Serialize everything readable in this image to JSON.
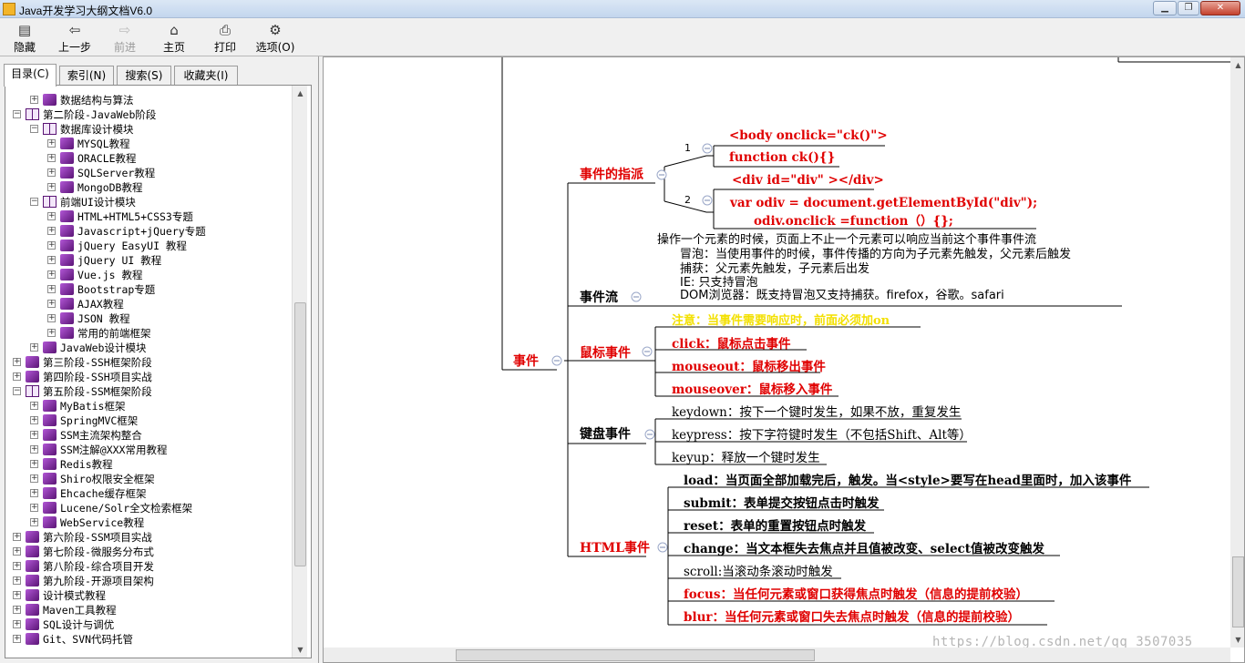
{
  "window": {
    "title": "Java开发学习大纲文档V6.0"
  },
  "toolbar": {
    "buttons": [
      {
        "label": "隐藏",
        "icon": "hide-icon"
      },
      {
        "label": "上一步",
        "icon": "back-arrow-icon"
      },
      {
        "label": "前进",
        "icon": "forward-arrow-icon"
      },
      {
        "label": "主页",
        "icon": "home-icon"
      },
      {
        "label": "打印",
        "icon": "print-icon"
      },
      {
        "label": "选项(O)",
        "icon": "options-icon"
      }
    ]
  },
  "tabs": [
    "目录(C)",
    "索引(N)",
    "搜索(S)",
    "收藏夹(I)"
  ],
  "tree": [
    {
      "level": 1,
      "exp": "+",
      "book": "closed",
      "label": "数据结构与算法"
    },
    {
      "level": 0,
      "exp": "-",
      "book": "open",
      "label": "第二阶段-JavaWeb阶段"
    },
    {
      "level": 1,
      "exp": "-",
      "book": "open",
      "label": "数据库设计模块"
    },
    {
      "level": 2,
      "exp": "+",
      "book": "closed",
      "label": "MYSQL教程"
    },
    {
      "level": 2,
      "exp": "+",
      "book": "closed",
      "label": "ORACLE教程"
    },
    {
      "level": 2,
      "exp": "+",
      "book": "closed",
      "label": "SQLServer教程"
    },
    {
      "level": 2,
      "exp": "+",
      "book": "closed",
      "label": "MongoDB教程"
    },
    {
      "level": 1,
      "exp": "-",
      "book": "open",
      "label": "前端UI设计模块"
    },
    {
      "level": 2,
      "exp": "+",
      "book": "closed",
      "label": "HTML+HTML5+CSS3专题"
    },
    {
      "level": 2,
      "exp": "+",
      "book": "closed",
      "label": "Javascript+jQuery专题"
    },
    {
      "level": 2,
      "exp": "+",
      "book": "closed",
      "label": "jQuery EasyUI 教程"
    },
    {
      "level": 2,
      "exp": "+",
      "book": "closed",
      "label": "jQuery UI 教程"
    },
    {
      "level": 2,
      "exp": "+",
      "book": "closed",
      "label": "Vue.js 教程"
    },
    {
      "level": 2,
      "exp": "+",
      "book": "closed",
      "label": "Bootstrap专题"
    },
    {
      "level": 2,
      "exp": "+",
      "book": "closed",
      "label": "AJAX教程"
    },
    {
      "level": 2,
      "exp": "+",
      "book": "closed",
      "label": "JSON 教程"
    },
    {
      "level": 2,
      "exp": "+",
      "book": "closed",
      "label": "常用的前端框架"
    },
    {
      "level": 1,
      "exp": "+",
      "book": "closed",
      "label": "JavaWeb设计模块"
    },
    {
      "level": 0,
      "exp": "+",
      "book": "closed",
      "label": "第三阶段-SSH框架阶段"
    },
    {
      "level": 0,
      "exp": "+",
      "book": "closed",
      "label": "第四阶段-SSH项目实战"
    },
    {
      "level": 0,
      "exp": "-",
      "book": "open",
      "label": "第五阶段-SSM框架阶段"
    },
    {
      "level": 1,
      "exp": "+",
      "book": "closed",
      "label": "MyBatis框架"
    },
    {
      "level": 1,
      "exp": "+",
      "book": "closed",
      "label": "SpringMVC框架"
    },
    {
      "level": 1,
      "exp": "+",
      "book": "closed",
      "label": "SSM主流架构整合"
    },
    {
      "level": 1,
      "exp": "+",
      "book": "closed",
      "label": "SSM注解@XXX常用教程"
    },
    {
      "level": 1,
      "exp": "+",
      "book": "closed",
      "label": "Redis教程"
    },
    {
      "level": 1,
      "exp": "+",
      "book": "closed",
      "label": "Shiro权限安全框架"
    },
    {
      "level": 1,
      "exp": "+",
      "book": "closed",
      "label": "Ehcache缓存框架"
    },
    {
      "level": 1,
      "exp": "+",
      "book": "closed",
      "label": "Lucene/Solr全文检索框架"
    },
    {
      "level": 1,
      "exp": "+",
      "book": "closed",
      "label": "WebService教程"
    },
    {
      "level": 0,
      "exp": "+",
      "book": "closed",
      "label": "第六阶段-SSM项目实战"
    },
    {
      "level": 0,
      "exp": "+",
      "book": "closed",
      "label": "第七阶段-微服务分布式"
    },
    {
      "level": 0,
      "exp": "+",
      "book": "closed",
      "label": "第八阶段-综合项目开发"
    },
    {
      "level": 0,
      "exp": "+",
      "book": "closed",
      "label": "第九阶段-开源项目架构"
    },
    {
      "level": 0,
      "exp": "+",
      "book": "closed",
      "label": "设计模式教程"
    },
    {
      "level": 0,
      "exp": "+",
      "book": "closed",
      "label": "Maven工具教程"
    },
    {
      "level": 0,
      "exp": "+",
      "book": "closed",
      "label": "SQL设计与调优"
    },
    {
      "level": 0,
      "exp": "+",
      "book": "closed",
      "label": "Git、SVN代码托管"
    }
  ],
  "mindmap": {
    "root": "事件",
    "dispatch": {
      "label": "事件的指派",
      "n1": "1",
      "n2": "2",
      "items": [
        "<body onclick=\"ck()\">",
        "function ck(){}",
        "<div id=\"div\" ></div>"
      ],
      "code_line1": "var odiv = document.getElementById(\"div\");",
      "code_line2": "odiv.onclick =function（）{};"
    },
    "flow": {
      "label": "事件流",
      "lines": [
        "操作一个元素的时候，页面上不止一个元素可以响应当前这个事件事件流",
        "冒泡：当使用事件的时候，事件传播的方向为子元素先触发，父元素后触发",
        "捕获：父元素先触发，子元素后出发",
        "IE: 只支持冒泡",
        "DOM浏览器：既支持冒泡又支持捕获。firefox，谷歌。safari"
      ]
    },
    "mouse": {
      "label": "鼠标事件",
      "note": "注意：当事件需要响应时，前面必须加on",
      "items": [
        "click：鼠标点击事件",
        "mouseout：鼠标移出事件",
        "mouseover：鼠标移入事件"
      ]
    },
    "keyboard": {
      "label": "键盘事件",
      "items": [
        "keydown：按下一个键时发生，如果不放，重复发生",
        "keypress：按下字符键时发生（不包括Shift、Alt等）",
        "keyup：释放一个键时发生"
      ]
    },
    "html": {
      "label": "HTML事件",
      "items": [
        "load：当页面全部加载完后，触发。当<style>要写在head里面时，加入该事件",
        "submit：表单提交按钮点击时触发",
        "reset：表单的重置按钮点时触发",
        "change：当文本框失去焦点并且值被改变、select值被改变触发",
        "scroll:当滚动条滚动时触发",
        "focus：当任何元素或窗口获得焦点时触发（信息的提前校验）",
        "blur：当任何元素或窗口失去焦点时触发（信息的提前校验）"
      ]
    }
  },
  "watermark": "https://blog.csdn.net/qq_3507035",
  "colors": {
    "red": "#e00000",
    "yellow": "#f3e000"
  }
}
